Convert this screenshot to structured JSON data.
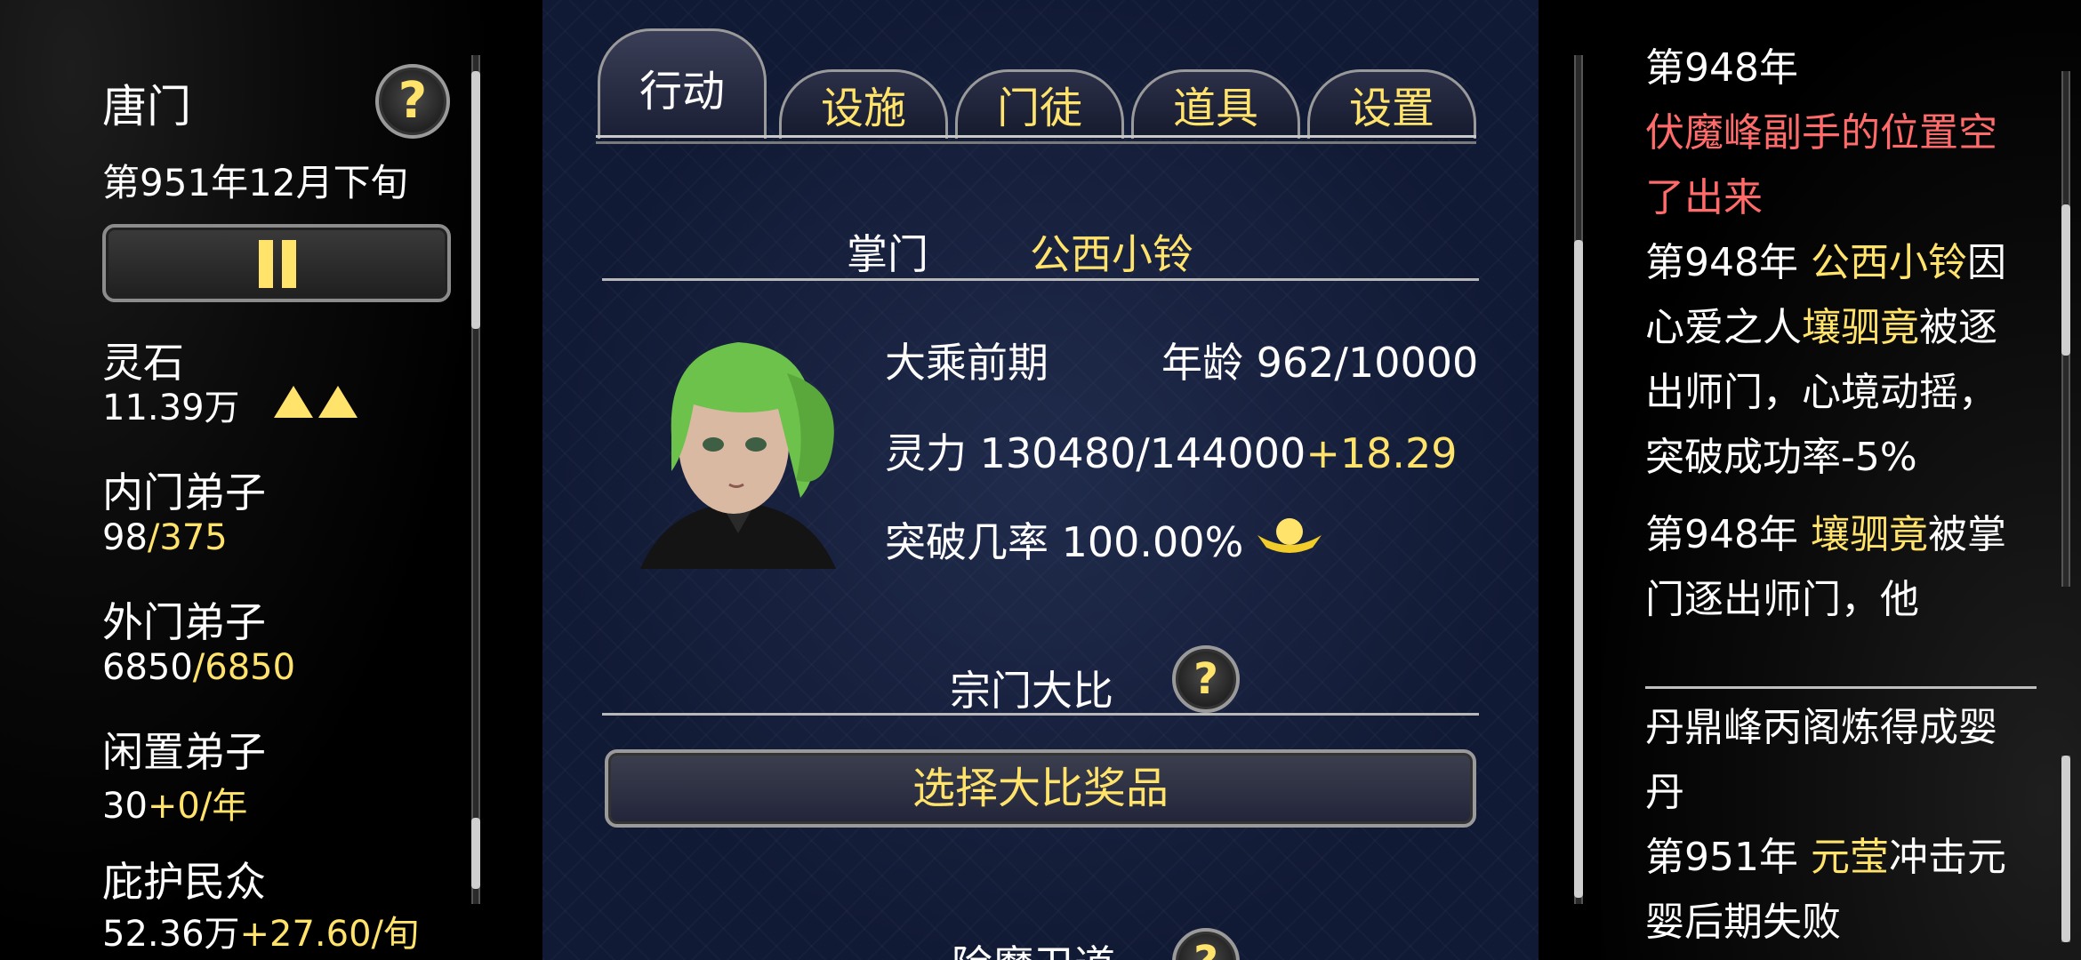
{
  "sidebar": {
    "sect_name": "唐门",
    "date": "第951年12月下旬",
    "help_icon": "?",
    "stats": [
      {
        "label": "灵石",
        "value": "11.39万",
        "value_extra": ""
      },
      {
        "label": "内门弟子",
        "value": "98",
        "value_extra": "/375"
      },
      {
        "label": "外门弟子",
        "value": "6850",
        "value_extra": "/6850"
      },
      {
        "label": "闲置弟子",
        "value": "30",
        "value_extra": "+0/年"
      },
      {
        "label": "庇护民众",
        "value": "52.36万",
        "value_extra": "+27.60/旬"
      }
    ]
  },
  "tabs": [
    {
      "label": "行动",
      "active": true
    },
    {
      "label": "设施",
      "active": false
    },
    {
      "label": "门徒",
      "active": false
    },
    {
      "label": "道具",
      "active": false
    },
    {
      "label": "设置",
      "active": false
    }
  ],
  "leader": {
    "title_label": "掌门",
    "name": "公西小铃",
    "realm": "大乘前期",
    "age_label": "年龄",
    "age_value": "962/10000",
    "spirit_label": "灵力",
    "spirit_value": "130480/144000",
    "spirit_rate": "+18.29",
    "breakthrough_label": "突破几率",
    "breakthrough_value": "100.00%"
  },
  "tournament": {
    "title": "宗门大比",
    "button_label": "选择大比奖品",
    "next_title": "除魔卫道"
  },
  "log_top": [
    {
      "parts": [
        {
          "t": "第948年",
          "c": "white"
        }
      ]
    },
    {
      "parts": [
        {
          "t": "伏魔峰副手的位置空了出来",
          "c": "red"
        }
      ]
    },
    {
      "parts": [
        {
          "t": "第948年 ",
          "c": "white"
        },
        {
          "t": "公西小铃",
          "c": "yellow"
        },
        {
          "t": "因心爱之人",
          "c": "white"
        },
        {
          "t": "壤驷竟",
          "c": "yellow"
        },
        {
          "t": "被逐出师门，心境动摇，突破成功率-5%",
          "c": "white"
        }
      ]
    },
    {
      "parts": [
        {
          "t": "第948年 ",
          "c": "white"
        },
        {
          "t": "壤驷竟",
          "c": "yellow"
        },
        {
          "t": "被掌门逐出师门，他",
          "c": "white"
        }
      ]
    }
  ],
  "log_bottom": [
    {
      "parts": [
        {
          "t": "丹鼎峰丙阁炼得成婴丹",
          "c": "white"
        }
      ]
    },
    {
      "parts": [
        {
          "t": "第951年 ",
          "c": "white"
        },
        {
          "t": "元莹",
          "c": "yellow"
        },
        {
          "t": "冲击元婴后期失败",
          "c": "white"
        }
      ]
    }
  ],
  "colors": {
    "accent": "#ffe36b",
    "alert": "#ff6a6a",
    "panel": "#111a34"
  },
  "icons": {
    "pause": "pause-icon",
    "help": "question-icon",
    "coin": "gold-ingot-icon",
    "rising": "up-triangle-icon"
  }
}
